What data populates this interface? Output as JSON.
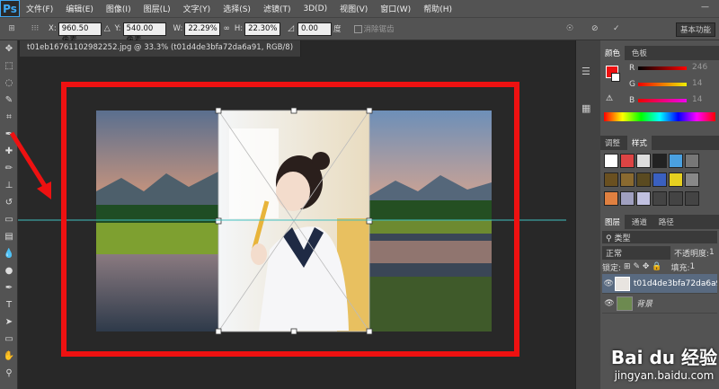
{
  "menu": [
    "文件(F)",
    "编辑(E)",
    "图像(I)",
    "图层(L)",
    "文字(Y)",
    "选择(S)",
    "滤镜(T)",
    "3D(D)",
    "视图(V)",
    "窗口(W)",
    "帮助(H)"
  ],
  "app_logo": "Ps",
  "options": {
    "x_label": "X:",
    "x": "960.50 像素",
    "y_label": "Y:",
    "y": "540.00 像素",
    "w_label": "W:",
    "w": "22.29%",
    "h_label": "H:",
    "h": "22.30%",
    "angle": "0.00",
    "angle_unit": "度",
    "interp": "消除锯齿",
    "essentials": "基本功能"
  },
  "doc_tab": "t01eb16761102982252.jpg @ 33.3% (t01d4de3bfa72da6a91, RGB/8)",
  "color_panel": {
    "tabs": [
      "颜色",
      "色板"
    ],
    "r_label": "R",
    "r": "246",
    "g_label": "G",
    "g": "14",
    "b_label": "B",
    "b": "14"
  },
  "styles_panel": {
    "tabs": [
      "调整",
      "样式"
    ]
  },
  "layers_panel": {
    "tabs": [
      "图层",
      "通道",
      "路径"
    ],
    "kind": "类型",
    "blend": "正常",
    "opacity_label": "不透明度:",
    "opacity": "1",
    "lock_label": "锁定:",
    "fill_label": "填充:",
    "fill": "1",
    "layers": [
      "t01d4de3bfa72da6a91",
      "背景"
    ]
  },
  "watermark": {
    "brand": "Bai du 经验",
    "url": "jingyan.baidu.com"
  },
  "colors": {
    "annotation": "#ee1111",
    "guide": "#40c0c0"
  }
}
